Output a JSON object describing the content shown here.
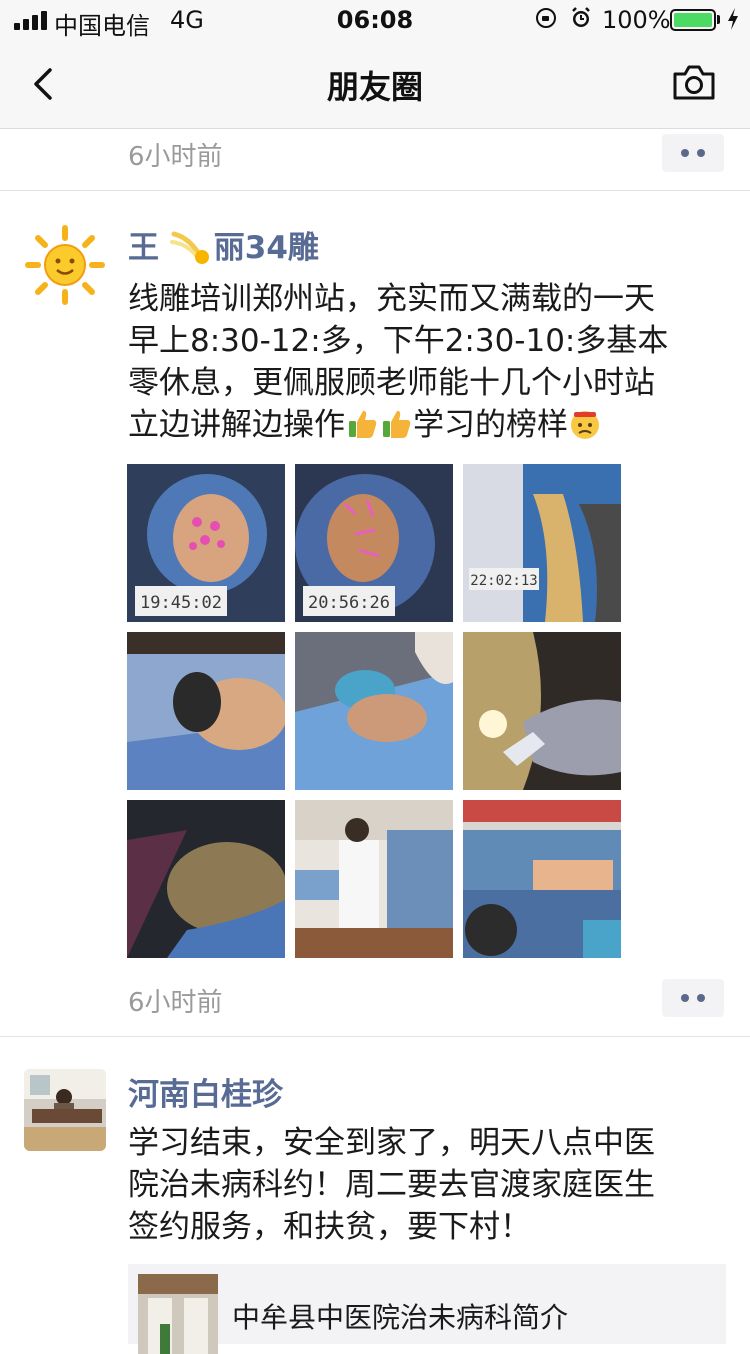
{
  "status_bar": {
    "carrier": "中国电信",
    "network": "4G",
    "time": "06:08",
    "battery_percent": "100%",
    "battery_level": 1.0,
    "battery_color": "#4cd964"
  },
  "nav": {
    "title": "朋友圈",
    "back_icon": "chevron-left-icon",
    "camera_icon": "camera-icon"
  },
  "feed": {
    "top_post_time": "6小时前",
    "posts": [
      {
        "author_prefix": "王",
        "author_suffix": "丽34雕",
        "lines": [
          "线雕培训郑州站，充实而又满载的一天",
          "早上8:30-12:多，下午2:30-10:多基本",
          "零休息，更佩服顾老师能十几个小时站"
        ],
        "last_line_a": "立边讲解边操作",
        "last_line_b": "学习的榜样",
        "time": "6小时前",
        "photo_count": 9,
        "photo_timestamps": [
          "19:45:02",
          "20:56:26",
          "22:02:13"
        ]
      },
      {
        "author": "河南白桂珍",
        "lines": [
          "学习结束，安全到家了，明天八点中医",
          "院治未病科约！周二要去官渡家庭医生",
          "签约服务，和扶贫，要下村！"
        ],
        "link_title": "中牟县中医院治未病科简介"
      }
    ]
  },
  "colors": {
    "author_blue": "#586b95",
    "time_gray": "#9a9a9a",
    "bar_bg": "#f7f7f7"
  }
}
